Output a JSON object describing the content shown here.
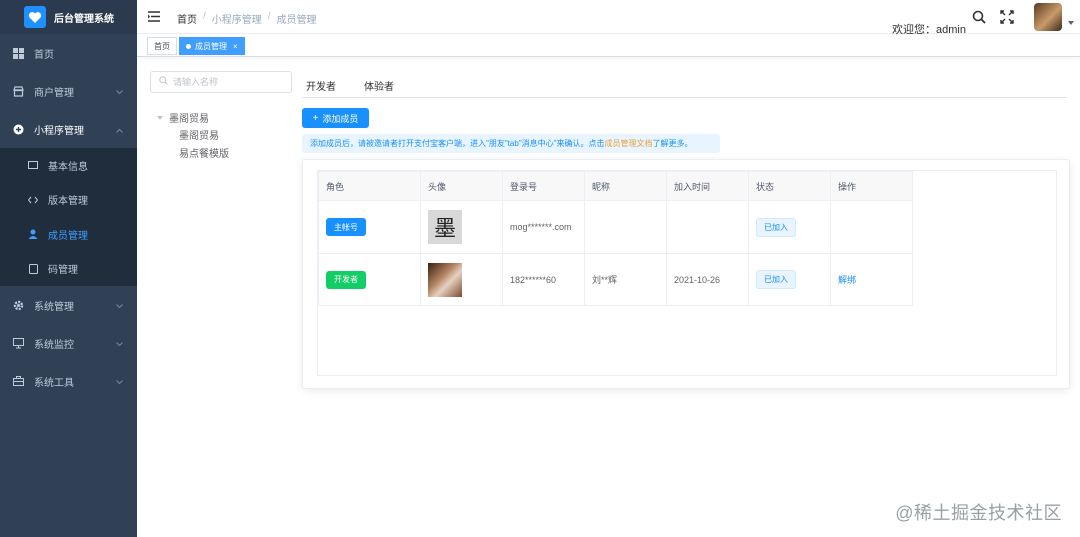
{
  "app": {
    "title": "后台管理系统"
  },
  "sidebar": {
    "items": [
      {
        "label": "首页",
        "icon": "dashboard-icon"
      },
      {
        "label": "商户管理",
        "icon": "store-icon"
      },
      {
        "label": "小程序管理",
        "icon": "plus-circle-icon",
        "open": true,
        "children": [
          {
            "label": "基本信息",
            "icon": "info-card-icon"
          },
          {
            "label": "版本管理",
            "icon": "code-icon"
          },
          {
            "label": "成员管理",
            "icon": "user-icon",
            "active": true
          },
          {
            "label": "码管理",
            "icon": "qrcode-icon"
          }
        ]
      },
      {
        "label": "系统管理",
        "icon": "gear-icon"
      },
      {
        "label": "系统监控",
        "icon": "monitor-icon"
      },
      {
        "label": "系统工具",
        "icon": "toolbox-icon"
      }
    ]
  },
  "navbar": {
    "breadcrumb": [
      "首页",
      "小程序管理",
      "成员管理"
    ],
    "welcome": "欢迎您：admin"
  },
  "tags": [
    {
      "label": "首页",
      "active": false
    },
    {
      "label": "成员管理",
      "active": true,
      "close": "×"
    }
  ],
  "tree": {
    "search_placeholder": "请输入名称",
    "nodes": [
      {
        "label": "墨阁贸易",
        "level": 0,
        "expanded": true
      },
      {
        "label": "墨阁贸易",
        "level": 1
      },
      {
        "label": "易点餐模版",
        "level": 1
      }
    ]
  },
  "tabs": [
    "开发者",
    "体验者"
  ],
  "add_button": {
    "label": "添加成员",
    "icon": "plus-icon"
  },
  "alert": {
    "prefix": "添加成员后，请被邀请者打开支付宝客户端，进入\"朋友\"tab\"消息中心\"来确认。点击",
    "link": "成员管理文档",
    "suffix": "了解更多。"
  },
  "table": {
    "columns": [
      "角色",
      "头像",
      "登录号",
      "昵称",
      "加入时间",
      "状态",
      "操作"
    ],
    "rows": [
      {
        "role": "主帐号",
        "role_color": "#1890ff",
        "avatar_glyph": "墨",
        "login": "mog*******.com",
        "nickname": "",
        "joined": "",
        "status": "已加入",
        "action": ""
      },
      {
        "role": "开发者",
        "role_color": "#13ce66",
        "login": "182******60",
        "nickname": "刘**辉",
        "joined": "2021-10-26",
        "status": "已加入",
        "action": "解绑"
      }
    ]
  },
  "watermark": "@稀土掘金技术社区",
  "colors": {
    "sidebar_bg": "#304156",
    "primary": "#1890ff",
    "success": "#13ce66",
    "link_orange": "#e6a23c"
  }
}
